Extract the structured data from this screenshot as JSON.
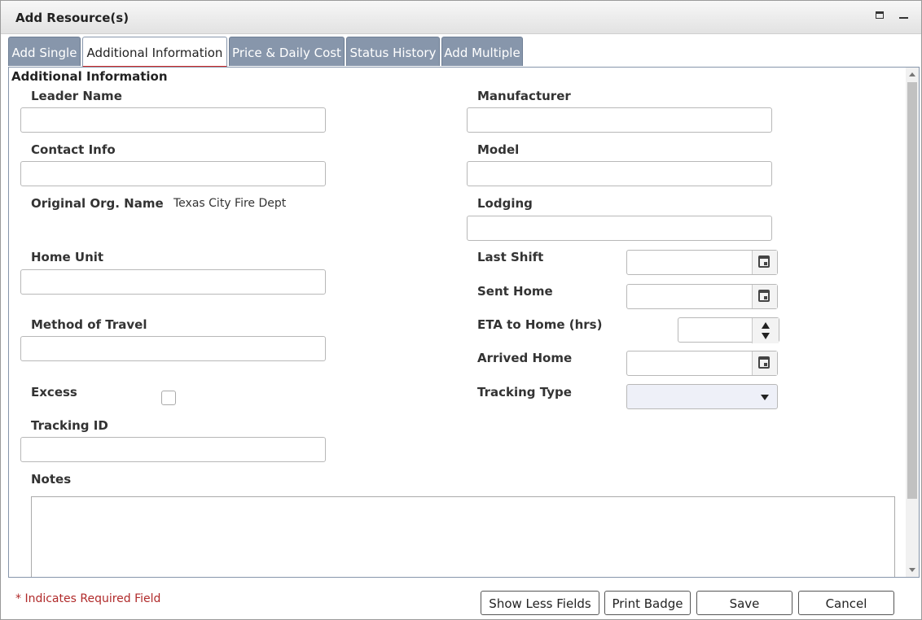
{
  "window": {
    "title": "Add Resource(s)"
  },
  "tabs": [
    {
      "label": "Add Single"
    },
    {
      "label": "Additional Information"
    },
    {
      "label": "Price & Daily Cost"
    },
    {
      "label": "Status History"
    },
    {
      "label": "Add Multiple"
    }
  ],
  "section": {
    "title": "Additional Information"
  },
  "fields": {
    "leader_name": {
      "label": "Leader Name",
      "value": ""
    },
    "contact_info": {
      "label": "Contact Info",
      "value": ""
    },
    "original_org": {
      "label": "Original Org. Name",
      "value": "Texas City Fire Dept"
    },
    "home_unit": {
      "label": "Home Unit",
      "value": ""
    },
    "method_of_travel": {
      "label": "Method of Travel",
      "value": ""
    },
    "excess": {
      "label": "Excess"
    },
    "tracking_id": {
      "label": "Tracking ID",
      "value": ""
    },
    "notes": {
      "label": "Notes",
      "value": ""
    },
    "manufacturer": {
      "label": "Manufacturer",
      "value": ""
    },
    "model": {
      "label": "Model",
      "value": ""
    },
    "lodging": {
      "label": "Lodging",
      "value": ""
    },
    "last_shift": {
      "label": "Last Shift",
      "value": ""
    },
    "sent_home": {
      "label": "Sent Home",
      "value": ""
    },
    "eta_home": {
      "label": "ETA to Home (hrs)",
      "value": ""
    },
    "arrived_home": {
      "label": "Arrived Home",
      "value": ""
    },
    "tracking_type": {
      "label": "Tracking Type",
      "value": ""
    }
  },
  "footer": {
    "required_note": "* Indicates Required Field",
    "show_less_label": "Show Less Fields",
    "print_badge_label": "Print Badge",
    "save_label": "Save",
    "cancel_label": "Cancel"
  }
}
